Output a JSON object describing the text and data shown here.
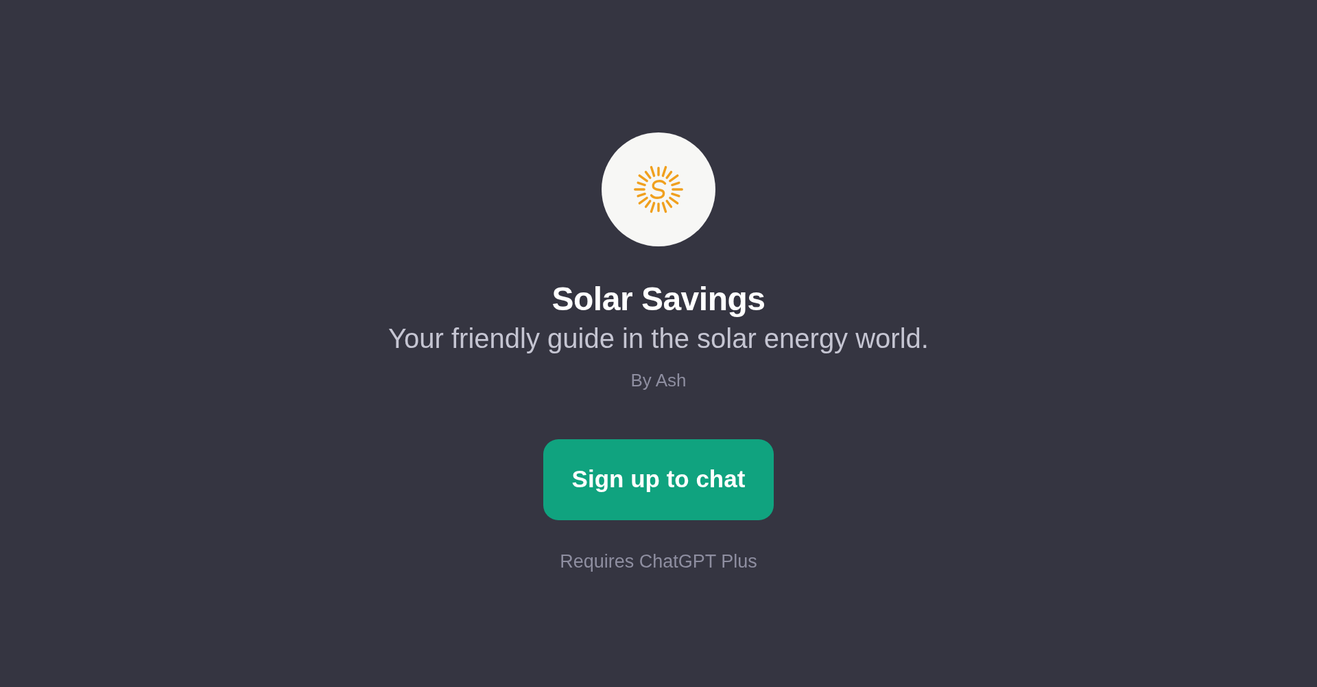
{
  "title": "Solar Savings",
  "description": "Your friendly guide in the solar energy world.",
  "author": "By Ash",
  "button": {
    "label": "Sign up to chat"
  },
  "note": "Requires ChatGPT Plus"
}
